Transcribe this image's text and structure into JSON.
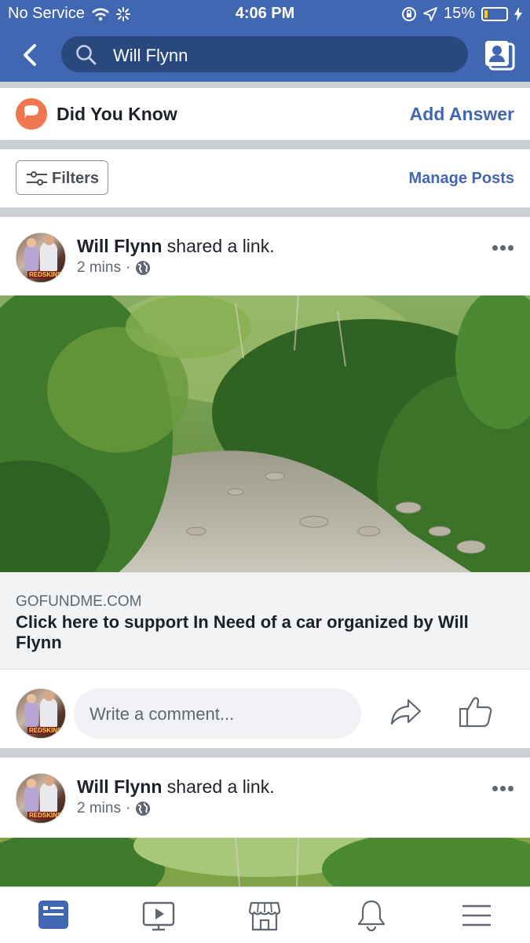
{
  "status_bar": {
    "carrier": "No Service",
    "time": "4:06 PM",
    "battery_percent": "15%",
    "battery_level": 0.15
  },
  "header": {
    "search_text": "Will Flynn",
    "colors": {
      "bar": "#4267b2",
      "search_bg": "#29487d"
    }
  },
  "did_you_know": {
    "title": "Did You Know",
    "action": "Add Answer"
  },
  "filters": {
    "filter_label": "Filters",
    "manage_label": "Manage Posts"
  },
  "posts": [
    {
      "author": "Will Flynn",
      "action": "shared a link.",
      "time": "2 mins",
      "privacy_icon": "globe-icon",
      "link": {
        "domain": "GOFUNDME.COM",
        "headline": "Click here to support In Need of a car organized by Will Flynn"
      },
      "comment_placeholder": "Write a comment..."
    },
    {
      "author": "Will Flynn",
      "action": "shared a link.",
      "time": "2 mins",
      "privacy_icon": "globe-icon"
    }
  ],
  "avatar_tag": "REDSKINS",
  "tab_bar": [
    {
      "icon": "news-feed-icon",
      "active": true
    },
    {
      "icon": "watch-icon",
      "active": false
    },
    {
      "icon": "marketplace-icon",
      "active": false
    },
    {
      "icon": "notifications-icon",
      "active": false
    },
    {
      "icon": "menu-icon",
      "active": false
    }
  ],
  "accent_color": "#4267b2"
}
